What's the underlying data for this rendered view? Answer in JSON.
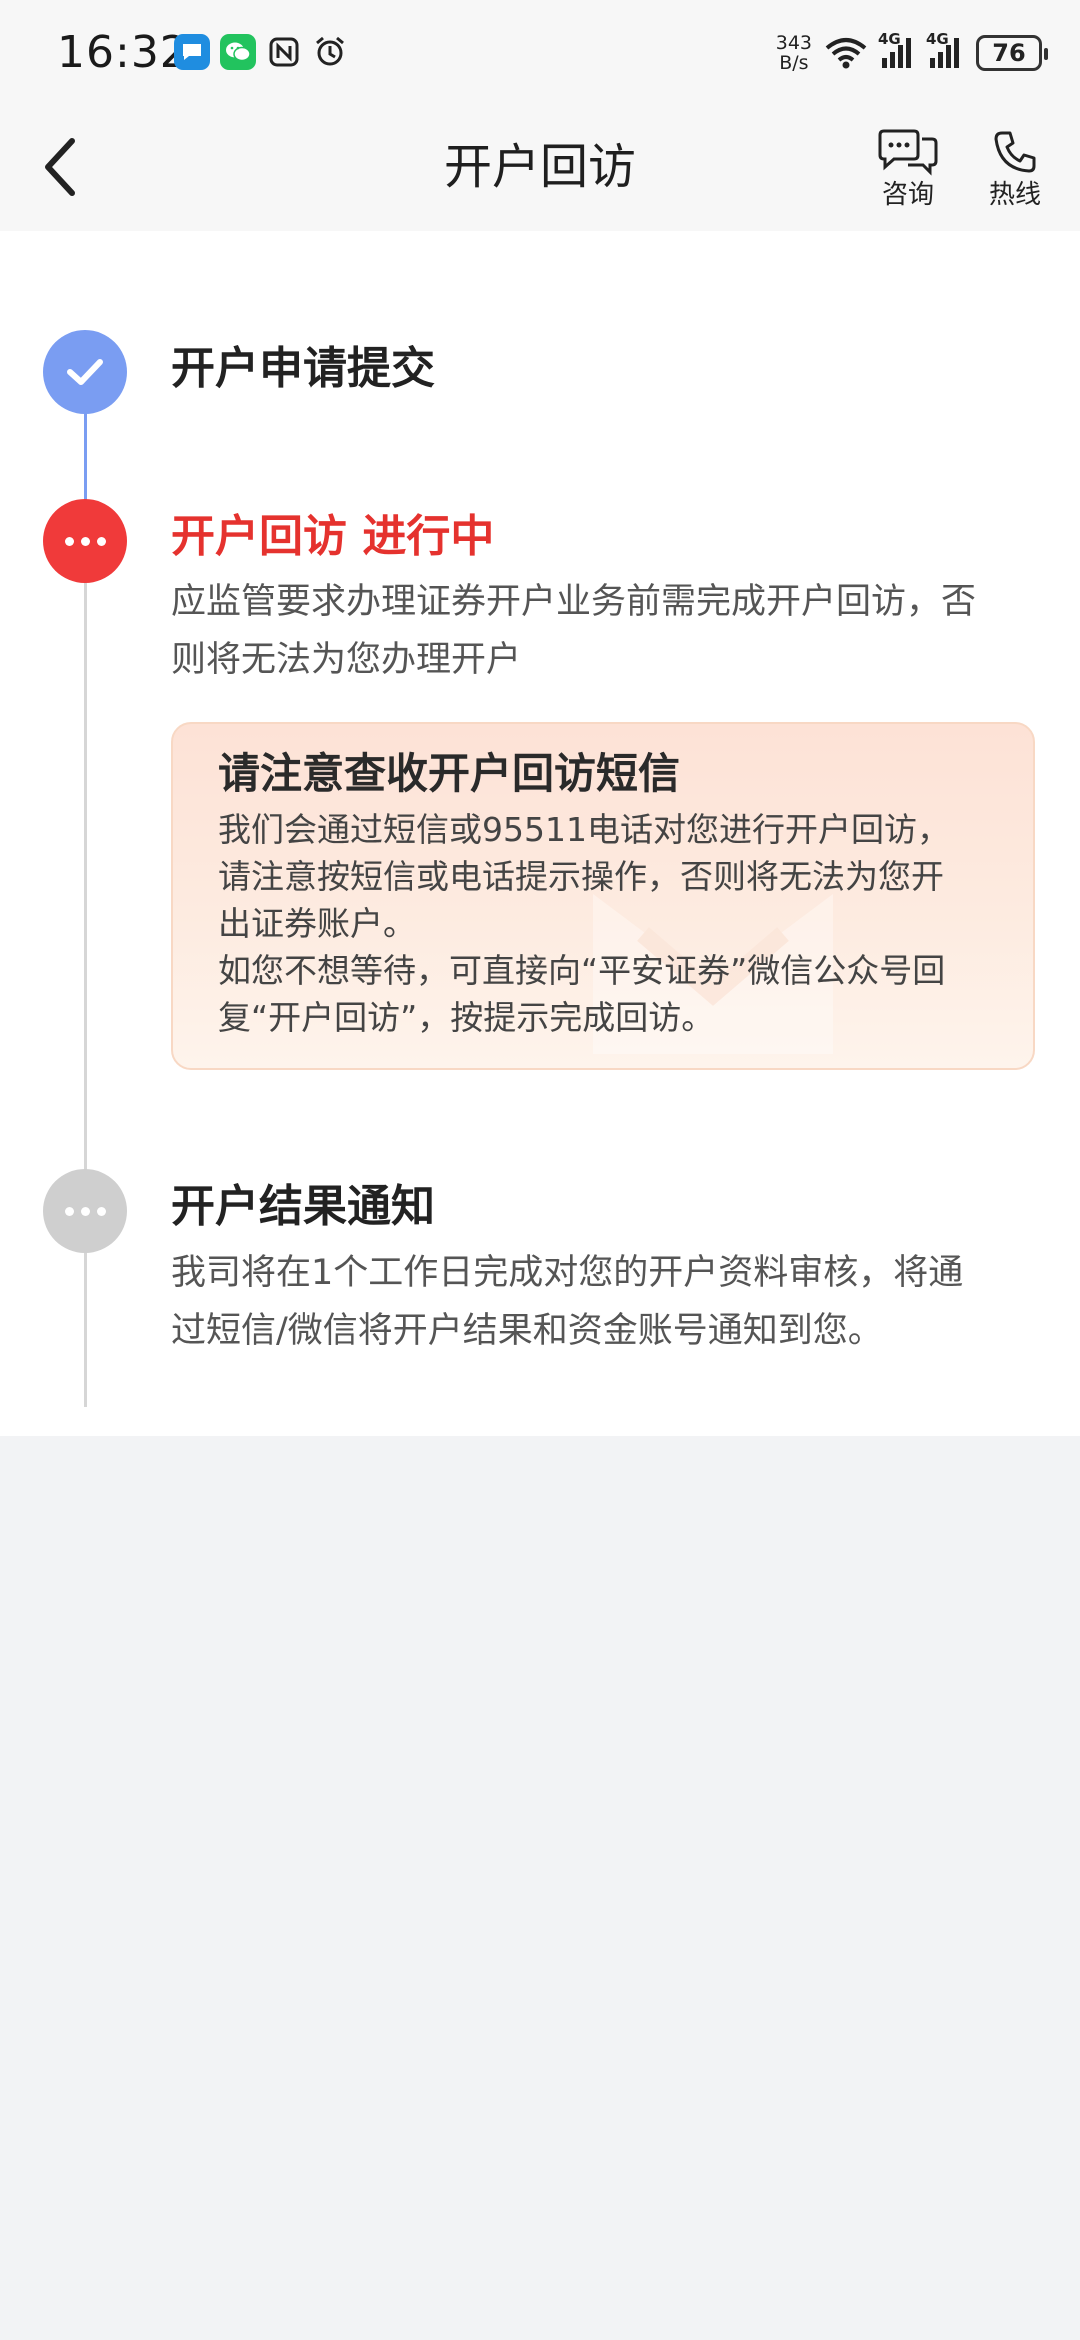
{
  "status_bar": {
    "time": "16:32",
    "net_speed_value": "343",
    "net_speed_unit": "B/s",
    "signal_tag_1": "4G",
    "signal_tag_2": "4G",
    "battery": "76",
    "icons": [
      "message-icon",
      "wechat-icon",
      "nfc-icon",
      "alarm-icon",
      "wifi-icon",
      "signal-icon",
      "signal-icon",
      "battery-icon"
    ]
  },
  "nav": {
    "title": "开户回访",
    "consult_label": "咨询",
    "hotline_label": "热线"
  },
  "steps": [
    {
      "title": "开户申请提交",
      "status": "done"
    },
    {
      "title": "开户回访 进行中",
      "status": "active",
      "description_lines": [
        "应监管要求办理证券开户业务前需完成开户回访，否",
        "则将无法为您办理开户"
      ]
    },
    {
      "title": "开户结果通知",
      "status": "pending",
      "description_lines": [
        "我司将在1个工作日完成对您的开户资料审核，将通",
        "过短信/微信将开户结果和资金账号通知到您。"
      ]
    }
  ],
  "notice": {
    "title": "请注意查收开户回访短信",
    "lines": [
      "我们会通过短信或95511电话对您进行开户回访，",
      "请注意按短信或电话提示操作，否则将无法为您开",
      "出证券账户。",
      "如您不想等待，可直接向“平安证券”微信公众号回",
      "复“开户回访”，按提示完成回访。"
    ]
  },
  "colors": {
    "done": "#7a9df2",
    "active": "#f03a3a",
    "active_text": "#e5322e",
    "pending": "#cfcfcf",
    "notice_border": "#f8d8c4",
    "page_background": "#f2f3f5"
  }
}
